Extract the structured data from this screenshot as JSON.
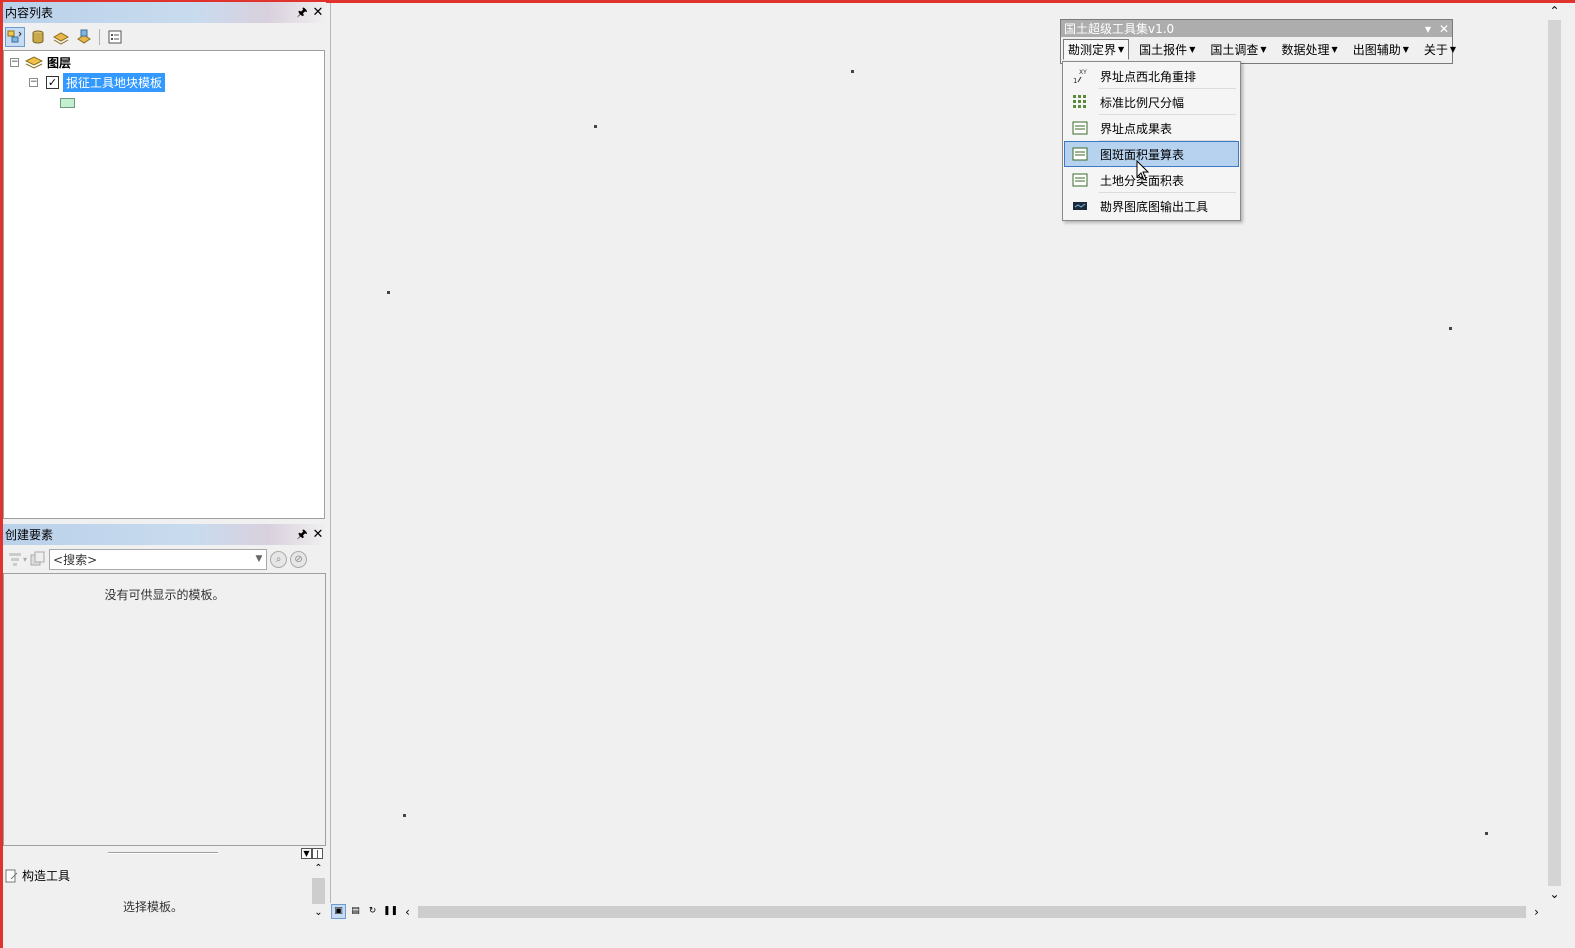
{
  "toc": {
    "title": "内容列表",
    "layers_root": "图层",
    "layer_name": "报征工具地块模板",
    "layer_checked": "✓"
  },
  "create_features": {
    "title": "创建要素",
    "search_placeholder": "<搜索>",
    "empty_message": "没有可供显示的模板。",
    "construct_tools": "构造工具",
    "construct_hint": "选择模板。"
  },
  "float_toolbar": {
    "title": "国土超级工具集v1.0",
    "menus": [
      "勘测定界",
      "国土报件",
      "国土调查",
      "数据处理",
      "出图辅助",
      "关于"
    ],
    "dropdown": {
      "items": [
        {
          "label": "界址点西北角重排",
          "icon": "xy-sort-icon"
        },
        {
          "label": "标准比例尺分幅",
          "icon": "grid-icon"
        },
        {
          "label": "界址点成果表",
          "icon": "table-icon"
        },
        {
          "label": "图斑面积量算表",
          "icon": "table-icon",
          "highlighted": true
        },
        {
          "label": "土地分类面积表",
          "icon": "table-icon"
        },
        {
          "label": "勘界图底图输出工具",
          "icon": "map-export-icon"
        }
      ]
    }
  },
  "colors": {
    "frame_border": "#e0332e",
    "selection": "#3399ff",
    "menu_highlight": "#b7d2ef",
    "panel_title": "#b9d1ea",
    "layer_swatch": "#c3eecf"
  }
}
